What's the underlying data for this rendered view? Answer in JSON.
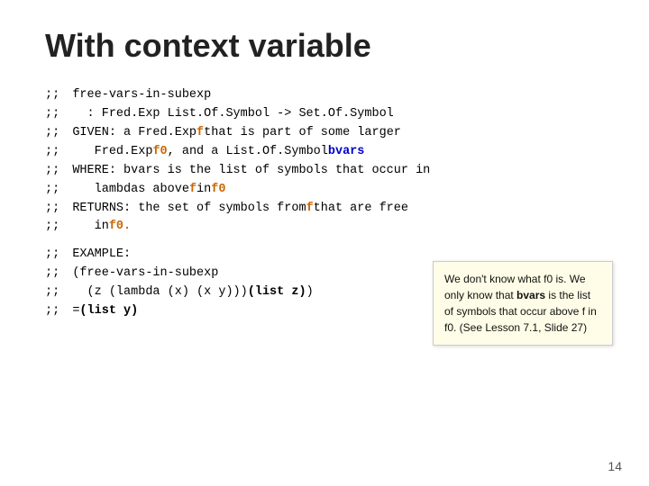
{
  "title": "With context variable",
  "code_lines": [
    {
      "prefix": ";;",
      "parts": [
        {
          "text": " free-vars-in-subexp",
          "style": "normal"
        }
      ]
    },
    {
      "prefix": ";;",
      "parts": [
        {
          "text": "   : Fred.Exp List.Of.Symbol -> Set.Of.Symbol",
          "style": "normal"
        }
      ]
    },
    {
      "prefix": ";;",
      "parts": [
        {
          "text": " GIVEN: a Fred.Exp ",
          "style": "normal"
        },
        {
          "text": "f",
          "style": "orange"
        },
        {
          "text": " that is part of some larger",
          "style": "normal"
        }
      ]
    },
    {
      "prefix": ";;",
      "parts": [
        {
          "text": "   Fred.Exp ",
          "style": "normal"
        },
        {
          "text": "f0",
          "style": "orange"
        },
        {
          "text": ", and a List.Of.Symbol ",
          "style": "normal"
        },
        {
          "text": "bvars",
          "style": "blue"
        }
      ]
    },
    {
      "prefix": ";;",
      "parts": [
        {
          "text": " WHERE: bvars is the list of symbols that occur in",
          "style": "normal"
        }
      ]
    },
    {
      "prefix": ";;",
      "parts": [
        {
          "text": "   lambdas above ",
          "style": "normal"
        },
        {
          "text": "f",
          "style": "orange"
        },
        {
          "text": " in ",
          "style": "normal"
        },
        {
          "text": "f0",
          "style": "orange"
        }
      ]
    },
    {
      "prefix": ";;",
      "parts": [
        {
          "text": " RETURNS: the set of symbols from ",
          "style": "normal"
        },
        {
          "text": "f",
          "style": "orange"
        },
        {
          "text": " that are free",
          "style": "normal"
        }
      ]
    },
    {
      "prefix": ";;",
      "parts": [
        {
          "text": "   in ",
          "style": "normal"
        },
        {
          "text": "f0.",
          "style": "orange"
        }
      ]
    }
  ],
  "example_lines": [
    {
      "prefix": ";;",
      "parts": [
        {
          "text": " EXAMPLE:",
          "style": "normal"
        }
      ]
    },
    {
      "prefix": ";;",
      "parts": [
        {
          "text": " (free-vars-in-subexp",
          "style": "normal"
        }
      ]
    },
    {
      "prefix": ";;",
      "parts": [
        {
          "text": "   (z (lambda (x) (x y))) ",
          "style": "normal"
        },
        {
          "text": "(list z)",
          "style": "bold"
        }
      ]
    },
    {
      "prefix": ";;",
      "parts": [
        {
          "text": " = ",
          "style": "normal"
        },
        {
          "text": "(list y)",
          "style": "bold"
        }
      ]
    }
  ],
  "tooltip": {
    "text1": "We don't know what f0 is.  We only know that ",
    "bold1": "bvars",
    "text2": " is the list of symbols that occur above f in f0. (See Lesson 7.1, Slide 27)"
  },
  "slide_number": "14"
}
